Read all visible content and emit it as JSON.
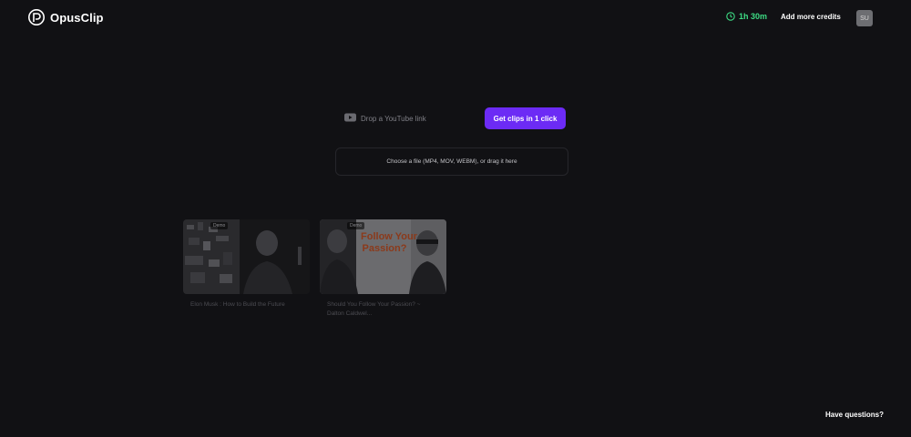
{
  "header": {
    "brand": "OpusClip",
    "credits_time": "1h 30m",
    "add_credits_label": "Add more credits",
    "avatar_initials": "SU",
    "accent_time_color": "#3ddc84"
  },
  "upload": {
    "youtube_placeholder": "Drop a YouTube link",
    "get_clips_label": "Get clips in 1 click",
    "dropzone_text": "Choose a file (MP4, MOV, WEBM), or drag it here",
    "primary_color": "#6c2bf5"
  },
  "demos": [
    {
      "badge": "Demo",
      "title": "Elon Musk : How to Build the Future"
    },
    {
      "badge": "Demo",
      "title": "Should You Follow Your Passion? ~ Dalton Caldwel...",
      "thumb_text": "Follow Your Passion?"
    }
  ],
  "footer": {
    "help_label": "Have questions?"
  }
}
